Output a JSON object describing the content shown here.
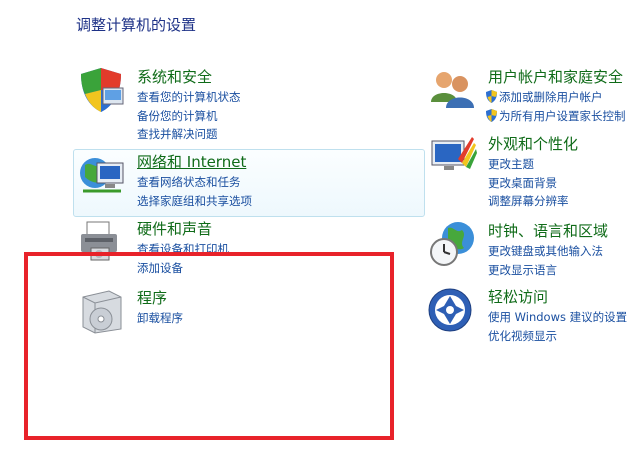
{
  "page_title": "调整计算机的设置",
  "left_categories": [
    {
      "title": "系统和安全",
      "links": [
        "查看您的计算机状态",
        "备份您的计算机",
        "查找并解决问题"
      ]
    },
    {
      "title": "网络和 Internet",
      "links": [
        "查看网络状态和任务",
        "选择家庭组和共享选项"
      ]
    },
    {
      "title": "硬件和声音",
      "links": [
        "查看设备和打印机",
        "添加设备"
      ]
    },
    {
      "title": "程序",
      "links": [
        "卸载程序"
      ]
    }
  ],
  "right_categories": [
    {
      "title": "用户帐户和家庭安全",
      "links": [
        "添加或删除用户帐户",
        "为所有用户设置家长控制"
      ]
    },
    {
      "title": "外观和个性化",
      "links": [
        "更改主题",
        "更改桌面背景",
        "调整屏幕分辨率"
      ]
    },
    {
      "title": "时钟、语言和区域",
      "links": [
        "更改键盘或其他输入法",
        "更改显示语言"
      ]
    },
    {
      "title": "轻松访问",
      "links": [
        "使用 Windows 建议的设置",
        "优化视频显示"
      ]
    }
  ],
  "colors": {
    "title_green": "#0f6b18",
    "link_blue": "#1a4fa0",
    "heading_blue": "#1e3287",
    "highlight_red": "#e8222a"
  }
}
